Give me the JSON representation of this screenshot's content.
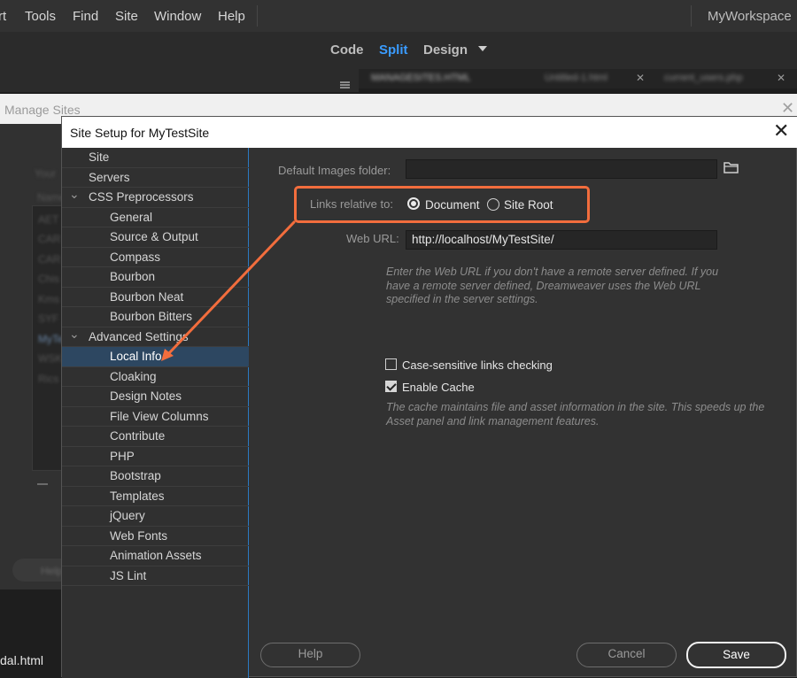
{
  "menubar": {
    "items": [
      "rt",
      "Tools",
      "Find",
      "Site",
      "Window",
      "Help"
    ],
    "workspace": "MyWorkspace"
  },
  "viewbar": {
    "code": "Code",
    "split": "Split",
    "design": "Design"
  },
  "tabs": {
    "tab1": "MANAGESITES.HTML",
    "tab2": "Untitled-1.html",
    "tab3": "current_users.php"
  },
  "manage_sites": {
    "title": "Manage Sites",
    "your_label": "Your",
    "name_label": "Name",
    "rows": [
      "AET",
      "CAR",
      "CAR",
      "Chis",
      "Kms",
      "SYF",
      "MyTe",
      "WSK",
      "Rics"
    ],
    "help": "Help"
  },
  "bottom_file": "dal.html",
  "setup": {
    "title": "Site Setup for MyTestSite",
    "nav": [
      {
        "label": "Site",
        "indent": 0
      },
      {
        "label": "Servers",
        "indent": 0
      },
      {
        "label": "CSS Preprocessors",
        "indent": 0,
        "expanded": true
      },
      {
        "label": "General",
        "indent": 1
      },
      {
        "label": "Source & Output",
        "indent": 1
      },
      {
        "label": "Compass",
        "indent": 1
      },
      {
        "label": "Bourbon",
        "indent": 1
      },
      {
        "label": "Bourbon Neat",
        "indent": 1
      },
      {
        "label": "Bourbon Bitters",
        "indent": 1
      },
      {
        "label": "Advanced Settings",
        "indent": 0,
        "expanded": true
      },
      {
        "label": "Local Info",
        "indent": 1,
        "selected": true
      },
      {
        "label": "Cloaking",
        "indent": 1
      },
      {
        "label": "Design Notes",
        "indent": 1
      },
      {
        "label": "File View Columns",
        "indent": 1
      },
      {
        "label": "Contribute",
        "indent": 1
      },
      {
        "label": "PHP",
        "indent": 1
      },
      {
        "label": "Bootstrap",
        "indent": 1
      },
      {
        "label": "Templates",
        "indent": 1
      },
      {
        "label": "jQuery",
        "indent": 1
      },
      {
        "label": "Web Fonts",
        "indent": 1
      },
      {
        "label": "Animation Assets",
        "indent": 1
      },
      {
        "label": "JS Lint",
        "indent": 1
      }
    ],
    "default_images_label": "Default Images folder:",
    "default_images_value": "",
    "links_relative_label": "Links relative to:",
    "radio_document": "Document",
    "radio_site_root": "Site Root",
    "selected_link_option": "Document",
    "web_url_label": "Web URL:",
    "web_url_value": "http://localhost/MyTestSite/",
    "web_url_note": "Enter the Web URL if you don't have a remote server defined. If you have a remote server defined, Dreamweaver uses the Web URL specified in the server settings.",
    "case_sensitive_label": "Case-sensitive links checking",
    "case_sensitive_checked": false,
    "enable_cache_label": "Enable Cache",
    "enable_cache_checked": true,
    "cache_note": "The cache maintains file and asset information in the site. This speeds up the Asset panel and link management features.",
    "help_button": "Help",
    "cancel_button": "Cancel",
    "save_button": "Save"
  },
  "colors": {
    "accent": "#3a9cff",
    "highlight": "#f26d3d",
    "selected_nav": "#2d4761"
  }
}
